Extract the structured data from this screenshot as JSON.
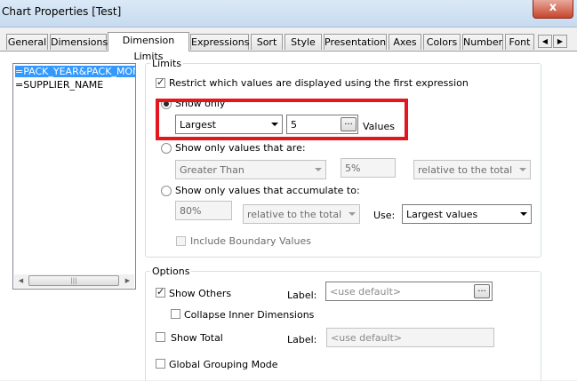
{
  "window": {
    "title": "Chart Properties [Test]",
    "close_label": "x"
  },
  "tabs": [
    {
      "label": "General"
    },
    {
      "label": "Dimensions"
    },
    {
      "label": "Dimension Limits"
    },
    {
      "label": "Expressions"
    },
    {
      "label": "Sort"
    },
    {
      "label": "Style"
    },
    {
      "label": "Presentation"
    },
    {
      "label": "Axes"
    },
    {
      "label": "Colors"
    },
    {
      "label": "Number"
    },
    {
      "label": "Font"
    }
  ],
  "active_tab": "Dimension Limits",
  "dimensions": [
    {
      "label": "=PACK_YEAR&PACK_MON",
      "selected": true
    },
    {
      "label": "=SUPPLIER_NAME",
      "selected": false
    }
  ],
  "limits": {
    "legend": "Limits",
    "restrict_label": "Restrict which values are displayed using the first expression",
    "restrict_checked": true,
    "show_only": {
      "label": "Show only",
      "selected": true,
      "mode": "Largest",
      "count": "5",
      "values_label": "Values"
    },
    "show_only_values": {
      "label": "Show only values that are:",
      "selected": false,
      "operator": "Greater Than",
      "amount": "5%",
      "relative": "relative to the total"
    },
    "accumulate": {
      "label": "Show only values that accumulate to:",
      "selected": false,
      "amount": "80%",
      "relative": "relative to the total",
      "use_label": "Use:",
      "use_value": "Largest values",
      "include_boundary_label": "Include Boundary Values",
      "include_boundary_checked": false
    }
  },
  "options": {
    "legend": "Options",
    "show_others": {
      "label": "Show Others",
      "checked": true,
      "label_caption": "Label:",
      "placeholder": "<use default>"
    },
    "collapse_inner": {
      "label": "Collapse Inner Dimensions",
      "checked": false
    },
    "show_total": {
      "label": "Show Total",
      "checked": false,
      "label_caption": "Label:",
      "placeholder": "<use default>"
    },
    "global_grouping": {
      "label": "Global Grouping Mode",
      "checked": false
    }
  },
  "ellipsis_label": "...",
  "highlight_color": "#e3161f"
}
